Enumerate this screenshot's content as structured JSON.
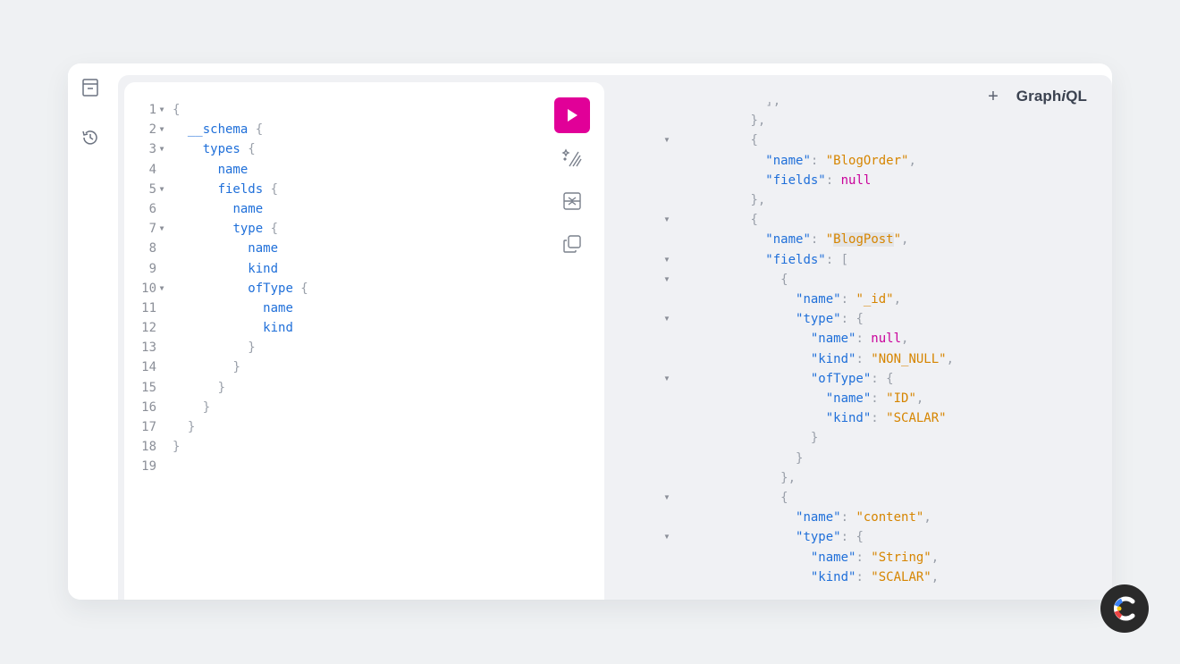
{
  "app": {
    "brand_main": "Graph",
    "brand_italic": "i",
    "brand_tail": "QL",
    "add_tab_label": "+"
  },
  "sidebar": {
    "icons": [
      "docs-icon",
      "history-icon"
    ]
  },
  "toolbar": {
    "run": "play-icon",
    "prettify": "magic-wand-icon",
    "merge": "merge-fragments-icon",
    "copy": "copy-icon"
  },
  "colors": {
    "accent": "#e10098",
    "field": "#1f6fd9",
    "string": "#d68500",
    "null": "#c9009a"
  },
  "editor": {
    "lines": [
      {
        "num": "1",
        "fold": true,
        "indent": "",
        "field": "",
        "brace": "{"
      },
      {
        "num": "2",
        "fold": true,
        "indent": "  ",
        "field": "__schema",
        "brace": " {"
      },
      {
        "num": "3",
        "fold": true,
        "indent": "    ",
        "field": "types",
        "brace": " {"
      },
      {
        "num": "4",
        "fold": false,
        "indent": "      ",
        "field": "name",
        "brace": ""
      },
      {
        "num": "5",
        "fold": true,
        "indent": "      ",
        "field": "fields",
        "brace": " {"
      },
      {
        "num": "6",
        "fold": false,
        "indent": "        ",
        "field": "name",
        "brace": ""
      },
      {
        "num": "7",
        "fold": true,
        "indent": "        ",
        "field": "type",
        "brace": " {"
      },
      {
        "num": "8",
        "fold": false,
        "indent": "          ",
        "field": "name",
        "brace": ""
      },
      {
        "num": "9",
        "fold": false,
        "indent": "          ",
        "field": "kind",
        "brace": ""
      },
      {
        "num": "10",
        "fold": true,
        "indent": "          ",
        "field": "ofType",
        "brace": " {"
      },
      {
        "num": "11",
        "fold": false,
        "indent": "            ",
        "field": "name",
        "brace": ""
      },
      {
        "num": "12",
        "fold": false,
        "indent": "            ",
        "field": "kind",
        "brace": ""
      },
      {
        "num": "13",
        "fold": false,
        "indent": "          ",
        "field": "",
        "brace": "}"
      },
      {
        "num": "14",
        "fold": false,
        "indent": "        ",
        "field": "",
        "brace": "}"
      },
      {
        "num": "15",
        "fold": false,
        "indent": "      ",
        "field": "",
        "brace": "}"
      },
      {
        "num": "16",
        "fold": false,
        "indent": "    ",
        "field": "",
        "brace": "}"
      },
      {
        "num": "17",
        "fold": false,
        "indent": "  ",
        "field": "",
        "brace": "}"
      },
      {
        "num": "18",
        "fold": false,
        "indent": "",
        "field": "",
        "brace": "}"
      },
      {
        "num": "19",
        "fold": false,
        "indent": "",
        "field": "",
        "brace": ""
      }
    ]
  },
  "results": {
    "lines": [
      {
        "fold": false,
        "indent": "          ",
        "tokens": [
          [
            "p",
            "],"
          ]
        ]
      },
      {
        "fold": false,
        "indent": "        ",
        "tokens": [
          [
            "p",
            "},"
          ]
        ]
      },
      {
        "fold": true,
        "indent": "        ",
        "tokens": [
          [
            "p",
            "{"
          ]
        ]
      },
      {
        "fold": false,
        "indent": "          ",
        "tokens": [
          [
            "k",
            "\"name\""
          ],
          [
            "p",
            ": "
          ],
          [
            "s",
            "\"BlogOrder\""
          ],
          [
            "p",
            ","
          ]
        ]
      },
      {
        "fold": false,
        "indent": "          ",
        "tokens": [
          [
            "k",
            "\"fields\""
          ],
          [
            "p",
            ": "
          ],
          [
            "n",
            "null"
          ]
        ]
      },
      {
        "fold": false,
        "indent": "        ",
        "tokens": [
          [
            "p",
            "},"
          ]
        ]
      },
      {
        "fold": true,
        "indent": "        ",
        "tokens": [
          [
            "p",
            "{"
          ]
        ]
      },
      {
        "fold": false,
        "indent": "          ",
        "tokens": [
          [
            "k",
            "\"name\""
          ],
          [
            "p",
            ": "
          ],
          [
            "s",
            "\""
          ],
          [
            "sh",
            "BlogPost"
          ],
          [
            "s",
            "\""
          ],
          [
            "p",
            ","
          ]
        ]
      },
      {
        "fold": true,
        "indent": "          ",
        "tokens": [
          [
            "k",
            "\"fields\""
          ],
          [
            "p",
            ": ["
          ]
        ]
      },
      {
        "fold": true,
        "indent": "            ",
        "tokens": [
          [
            "p",
            "{"
          ]
        ]
      },
      {
        "fold": false,
        "indent": "              ",
        "tokens": [
          [
            "k",
            "\"name\""
          ],
          [
            "p",
            ": "
          ],
          [
            "s",
            "\"_id\""
          ],
          [
            "p",
            ","
          ]
        ]
      },
      {
        "fold": true,
        "indent": "              ",
        "tokens": [
          [
            "k",
            "\"type\""
          ],
          [
            "p",
            ": {"
          ]
        ]
      },
      {
        "fold": false,
        "indent": "                ",
        "tokens": [
          [
            "k",
            "\"name\""
          ],
          [
            "p",
            ": "
          ],
          [
            "n",
            "null"
          ],
          [
            "p",
            ","
          ]
        ]
      },
      {
        "fold": false,
        "indent": "                ",
        "tokens": [
          [
            "k",
            "\"kind\""
          ],
          [
            "p",
            ": "
          ],
          [
            "s",
            "\"NON_NULL\""
          ],
          [
            "p",
            ","
          ]
        ]
      },
      {
        "fold": true,
        "indent": "                ",
        "tokens": [
          [
            "k",
            "\"ofType\""
          ],
          [
            "p",
            ": {"
          ]
        ]
      },
      {
        "fold": false,
        "indent": "                  ",
        "tokens": [
          [
            "k",
            "\"name\""
          ],
          [
            "p",
            ": "
          ],
          [
            "s",
            "\"ID\""
          ],
          [
            "p",
            ","
          ]
        ]
      },
      {
        "fold": false,
        "indent": "                  ",
        "tokens": [
          [
            "k",
            "\"kind\""
          ],
          [
            "p",
            ": "
          ],
          [
            "s",
            "\"SCALAR\""
          ]
        ]
      },
      {
        "fold": false,
        "indent": "                ",
        "tokens": [
          [
            "p",
            "}"
          ]
        ]
      },
      {
        "fold": false,
        "indent": "              ",
        "tokens": [
          [
            "p",
            "}"
          ]
        ]
      },
      {
        "fold": false,
        "indent": "            ",
        "tokens": [
          [
            "p",
            "},"
          ]
        ]
      },
      {
        "fold": true,
        "indent": "            ",
        "tokens": [
          [
            "p",
            "{"
          ]
        ]
      },
      {
        "fold": false,
        "indent": "              ",
        "tokens": [
          [
            "k",
            "\"name\""
          ],
          [
            "p",
            ": "
          ],
          [
            "s",
            "\"content\""
          ],
          [
            "p",
            ","
          ]
        ]
      },
      {
        "fold": true,
        "indent": "              ",
        "tokens": [
          [
            "k",
            "\"type\""
          ],
          [
            "p",
            ": {"
          ]
        ]
      },
      {
        "fold": false,
        "indent": "                ",
        "tokens": [
          [
            "k",
            "\"name\""
          ],
          [
            "p",
            ": "
          ],
          [
            "s",
            "\"String\""
          ],
          [
            "p",
            ","
          ]
        ]
      },
      {
        "fold": false,
        "indent": "                ",
        "tokens": [
          [
            "k",
            "\"kind\""
          ],
          [
            "p",
            ": "
          ],
          [
            "s",
            "\"SCALAR\""
          ],
          [
            "p",
            ","
          ]
        ]
      }
    ]
  }
}
